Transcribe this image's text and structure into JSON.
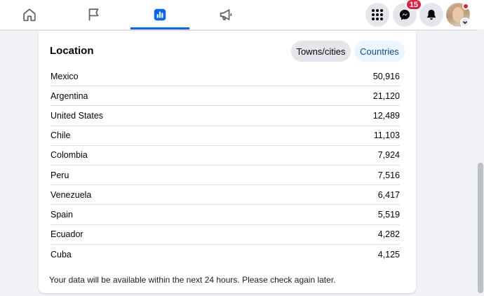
{
  "nav": {
    "tabs": [
      {
        "icon": "home-icon",
        "active": false
      },
      {
        "icon": "flag-icon",
        "active": false
      },
      {
        "icon": "insights-icon",
        "active": true
      },
      {
        "icon": "megaphone-icon",
        "active": false
      }
    ],
    "messenger_badge": "15"
  },
  "location": {
    "title": "Location",
    "filters": {
      "towns": "Towns/cities",
      "countries": "Countries",
      "selected": "Countries"
    },
    "rows": [
      {
        "name": "Mexico",
        "value": "50,916"
      },
      {
        "name": "Argentina",
        "value": "21,120"
      },
      {
        "name": "United States",
        "value": "12,489"
      },
      {
        "name": "Chile",
        "value": "11,103"
      },
      {
        "name": "Colombia",
        "value": "7,924"
      },
      {
        "name": "Peru",
        "value": "7,516"
      },
      {
        "name": "Venezuela",
        "value": "6,417"
      },
      {
        "name": "Spain",
        "value": "5,519"
      },
      {
        "name": "Ecuador",
        "value": "4,282"
      },
      {
        "name": "Cuba",
        "value": "4,125"
      }
    ],
    "note": "Your data will be available within the next 24 hours. Please check again later."
  },
  "colors": {
    "accent": "#0866ff",
    "badge": "#e41e3f"
  }
}
